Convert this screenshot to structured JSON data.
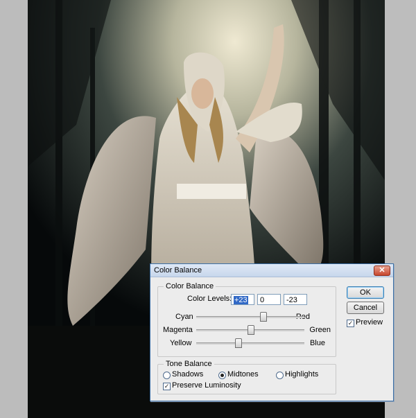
{
  "dialog": {
    "title": "Color Balance",
    "close_icon": "close-icon",
    "color_balance_group": "Color Balance",
    "color_levels_label": "Color Levels:",
    "levels": [
      "+23",
      "0",
      "-23"
    ],
    "sliders": [
      {
        "left": "Cyan",
        "right": "Red",
        "value": 23
      },
      {
        "left": "Magenta",
        "right": "Green",
        "value": 0
      },
      {
        "left": "Yellow",
        "right": "Blue",
        "value": -23
      }
    ],
    "tone_balance_group": "Tone Balance",
    "tones": [
      "Shadows",
      "Midtones",
      "Highlights"
    ],
    "selected_tone": "Midtones",
    "preserve_luminosity": {
      "label": "Preserve Luminosity",
      "checked": true
    },
    "ok": "OK",
    "cancel": "Cancel",
    "preview": {
      "label": "Preview",
      "checked": true
    },
    "accent": "#3169c6"
  }
}
